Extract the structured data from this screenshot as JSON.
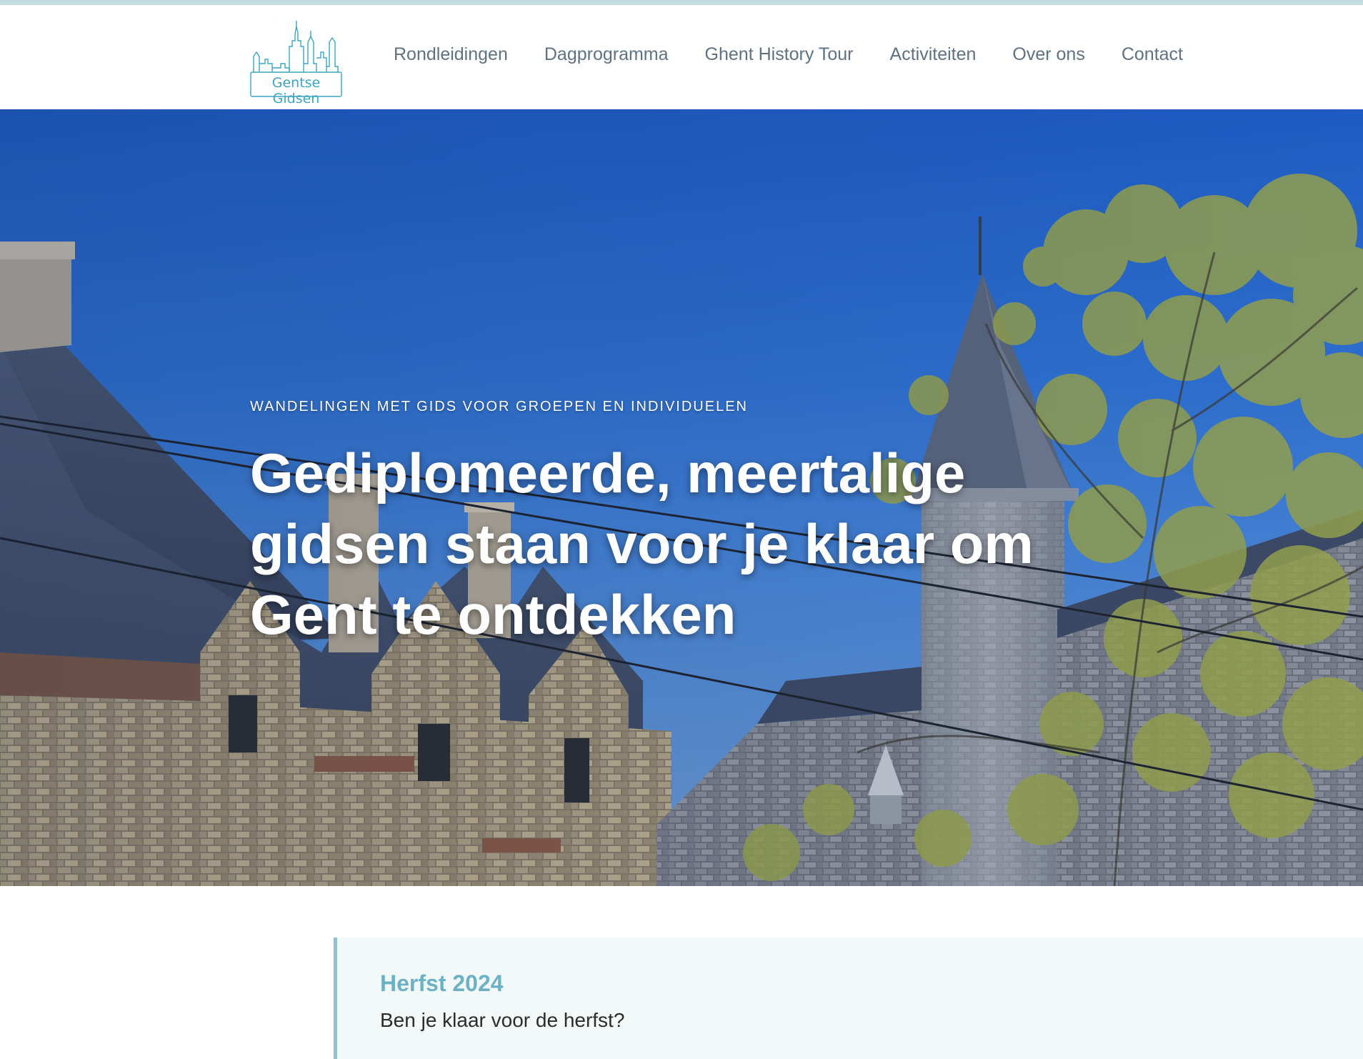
{
  "brand": {
    "name": "Gentse Gidsen",
    "logo_icon": "ghent-skyline-icon",
    "accent_color": "#3aa6c2"
  },
  "nav": {
    "items": [
      {
        "label": "Rondleidingen"
      },
      {
        "label": "Dagprogramma"
      },
      {
        "label": "Ghent History Tour"
      },
      {
        "label": "Activiteiten"
      },
      {
        "label": "Over ons"
      },
      {
        "label": "Contact"
      }
    ],
    "text_color": "#5e7283"
  },
  "hero": {
    "kicker": "WANDELINGEN MET GIDS VOOR GROEPEN EN INDIVIDUELEN",
    "title": "Gediplomeerde, meertalige gidsen staan voor je klaar om Gent te ontdekken",
    "image": "gravensteen-castle-photo"
  },
  "notice": {
    "title": "Herfst 2024",
    "text": "Ben je klaar voor de herfst?",
    "accent_color": "#8cc3d0"
  }
}
